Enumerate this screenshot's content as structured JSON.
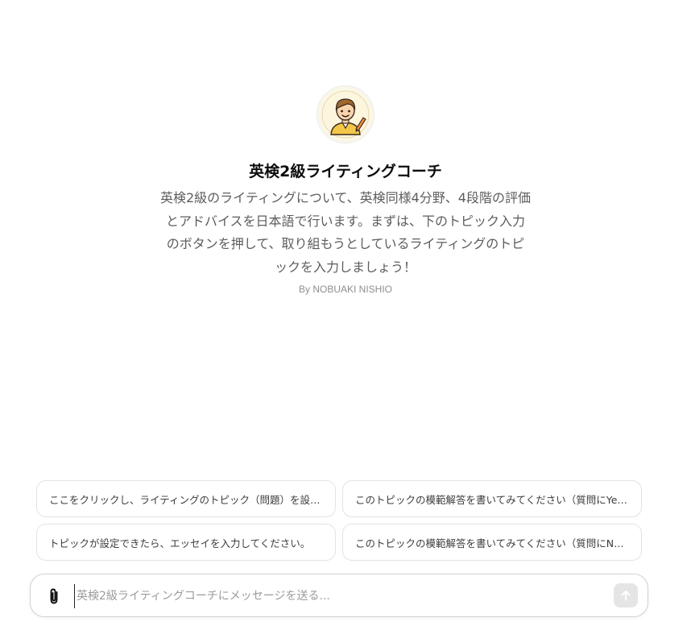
{
  "gpt": {
    "avatar_icon": "cartoon-teacher-avatar",
    "title": "英検2級ライティングコーチ",
    "description": "英検2級のライティングについて、英検同様4分野、4段階の評価とアドバイスを日本語で行います。まずは、下のトピック入力のボタンを押して、取り組もうとしているライティングのトピックを入力しましょう！",
    "author": "By NOBUAKI NISHIO"
  },
  "starters": [
    "ここをクリックし、ライティングのトピック（問題）を設定します。",
    "このトピックの模範解答を書いてみてください（質問にYesの...",
    "トピックが設定できたら、エッセイを入力してください。",
    "このトピックの模範解答を書いてみてください（質問にNoの..."
  ],
  "composer": {
    "placeholder": "英検2級ライティングコーチにメッセージを送る...",
    "attach_icon": "paperclip-icon",
    "send_icon": "arrow-up-icon"
  }
}
